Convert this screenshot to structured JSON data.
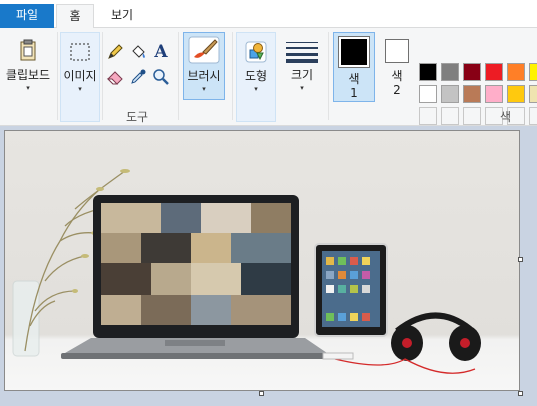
{
  "tabs": {
    "file": "파일",
    "home": "홈",
    "view": "보기"
  },
  "ribbon": {
    "clipboard": "클립보드",
    "image": "이미지",
    "tools_group": "도구",
    "brushes": "브러시",
    "shapes": "도형",
    "size": "크기",
    "color1_label": "색",
    "color1_num": "1",
    "color2_label": "색",
    "color2_num": "2",
    "colors_group": "색",
    "dropdown_glyph": "▾"
  },
  "colors": {
    "accent": "#1979ca",
    "color1": "#000000",
    "color2": "#ffffff",
    "palette_row1": [
      "#000000",
      "#7f7f7f",
      "#880015",
      "#ed1c24",
      "#ff7f27",
      "#fff200"
    ],
    "palette_row2": [
      "#ffffff",
      "#c3c3c3",
      "#b97a57",
      "#ffaec9",
      "#ffc90e",
      "#efe4b0"
    ]
  },
  "icons": {
    "pencil": "pencil-icon",
    "fill": "fill-bucket-icon",
    "text": "text-icon",
    "eraser": "eraser-icon",
    "picker": "color-picker-icon",
    "magnifier": "magnifier-icon"
  }
}
